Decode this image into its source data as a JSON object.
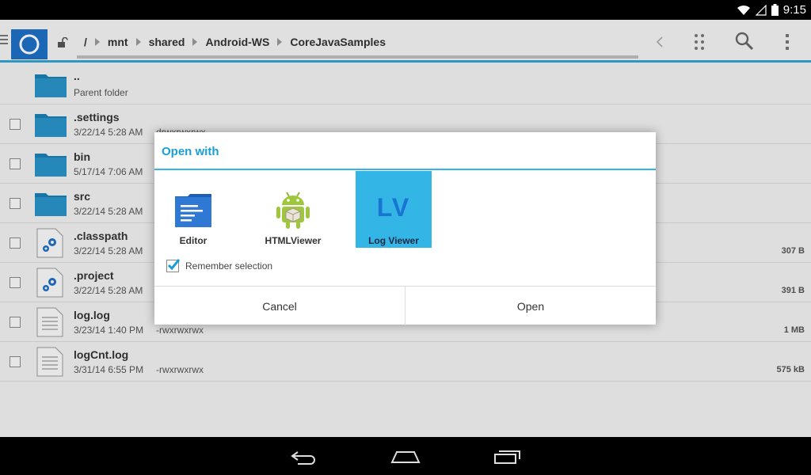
{
  "status": {
    "time": "9:15"
  },
  "breadcrumb": [
    "/",
    "mnt",
    "shared",
    "Android-WS",
    "CoreJavaSamples"
  ],
  "files": [
    {
      "name": "..",
      "meta": "Parent folder",
      "perm": "",
      "size": "",
      "type": "folder",
      "checkbox": false
    },
    {
      "name": ".settings",
      "meta": "3/22/14 5:28 AM",
      "perm": "drwxrwxrwx",
      "size": "",
      "type": "folder",
      "checkbox": true
    },
    {
      "name": "bin",
      "meta": "5/17/14 7:06 AM",
      "perm": "",
      "size": "",
      "type": "folder",
      "checkbox": true
    },
    {
      "name": "src",
      "meta": "3/22/14 5:28 AM",
      "perm": "",
      "size": "",
      "type": "folder",
      "checkbox": true
    },
    {
      "name": ".classpath",
      "meta": "3/22/14 5:28 AM",
      "perm": "",
      "size": "307 B",
      "type": "config",
      "checkbox": true
    },
    {
      "name": ".project",
      "meta": "3/22/14 5:28 AM",
      "perm": "",
      "size": "391 B",
      "type": "config",
      "checkbox": true
    },
    {
      "name": "log.log",
      "meta": "3/23/14 1:40 PM",
      "perm": "-rwxrwxrwx",
      "size": "1 MB",
      "type": "text",
      "checkbox": true
    },
    {
      "name": "logCnt.log",
      "meta": "3/31/14 6:55 PM",
      "perm": "-rwxrwxrwx",
      "size": "575 kB",
      "type": "text",
      "checkbox": true
    }
  ],
  "dialog": {
    "title": "Open with",
    "apps": [
      {
        "label": "Editor",
        "icon": "editor-icon",
        "selected": false
      },
      {
        "label": "HTMLViewer",
        "icon": "android-icon",
        "selected": false
      },
      {
        "label": "Log Viewer",
        "icon": "log-viewer-icon",
        "icon_text": "LV",
        "selected": true
      }
    ],
    "remember_label": "Remember selection",
    "remember_checked": true,
    "cancel_label": "Cancel",
    "open_label": "Open"
  },
  "colors": {
    "accent": "#33b5e5",
    "title": "#1a9ed8",
    "logo": "#1f6fc6"
  }
}
